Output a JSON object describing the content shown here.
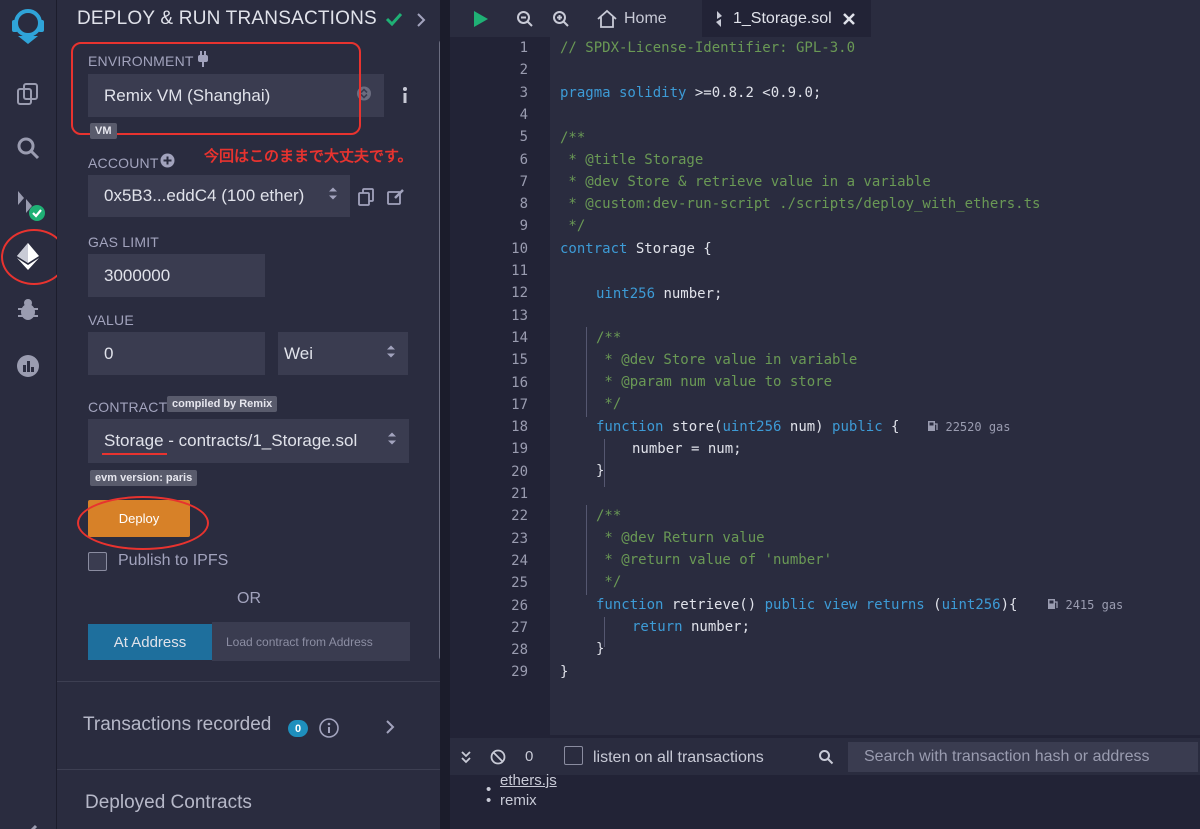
{
  "panel": {
    "title": "DEPLOY & RUN TRANSACTIONS",
    "environment_label": "ENVIRONMENT",
    "environment_value": "Remix VM (Shanghai)",
    "vm_badge": "VM",
    "note": "今回はこのままで大丈夫です。",
    "account_label": "ACCOUNT",
    "account_value": "0x5B3...eddC4 (100 ether)",
    "gas_limit_label": "GAS LIMIT",
    "gas_limit_value": "3000000",
    "value_label": "VALUE",
    "value_amount": "0",
    "value_unit": "Wei",
    "contract_label": "CONTRACT",
    "compiled_badge": "compiled by Remix",
    "contract_value": "Storage - contracts/1_Storage.sol",
    "evm_badge": "evm version: paris",
    "deploy_label": "Deploy",
    "publish_ipfs_label": "Publish to IPFS",
    "or_label": "OR",
    "at_address_label": "At Address",
    "load_address_placeholder": "Load contract from Address",
    "transactions_recorded_label": "Transactions recorded",
    "transactions_recorded_count": "0",
    "deployed_contracts_label": "Deployed Contracts"
  },
  "tabbar": {
    "home_label": "Home",
    "active_tab_label": "1_Storage.sol"
  },
  "editor": {
    "line_numbers": [
      "1",
      "2",
      "3",
      "4",
      "5",
      "6",
      "7",
      "8",
      "9",
      "10",
      "11",
      "12",
      "13",
      "14",
      "15",
      "16",
      "17",
      "18",
      "19",
      "20",
      "21",
      "22",
      "23",
      "24",
      "25",
      "26",
      "27",
      "28",
      "29"
    ],
    "lines": {
      "l1": "// SPDX-License-Identifier: GPL-3.0",
      "l3a": "pragma solidity",
      "l3b": " >=0.8.2 <0.9.0;",
      "l5": "/**",
      "l6": " * @title Storage",
      "l7": " * @dev Store & retrieve value in a variable",
      "l8": " * @custom:dev-run-script ./scripts/deploy_with_ethers.ts",
      "l9": " */",
      "l10a": "contract",
      "l10b": " Storage {",
      "l12a": "uint256",
      "l12b": " number;",
      "l14": "/**",
      "l15": " * @dev Store value in variable",
      "l16": " * @param num value to store",
      "l17": " */",
      "l18a": "function",
      "l18b": " store(",
      "l18c": "uint256",
      "l18d": " num) ",
      "l18e": "public",
      "l18f": " {",
      "l18gas": "22520 gas",
      "l19": "number = num;",
      "l20": "}",
      "l22": "/**",
      "l23": " * @dev Return value",
      "l24": " * @return value of 'number'",
      "l25": " */",
      "l26a": "function",
      "l26b": " retrieve() ",
      "l26c": "public view returns",
      "l26d": " (",
      "l26e": "uint256",
      "l26f": "){",
      "l26gas": "2415 gas",
      "l27a": "return",
      "l27b": " number;",
      "l28": "}",
      "l29": "}"
    }
  },
  "terminal": {
    "pending_count": "0",
    "listen_label": "listen on all transactions",
    "search_placeholder": "Search with transaction hash or address",
    "output_items": [
      "ethers.js",
      "remix"
    ]
  },
  "colors": {
    "accent_red": "#e8332f",
    "deploy_orange": "#d78128",
    "at_address_blue": "#1e6f9d",
    "success_green": "#1fb075"
  }
}
